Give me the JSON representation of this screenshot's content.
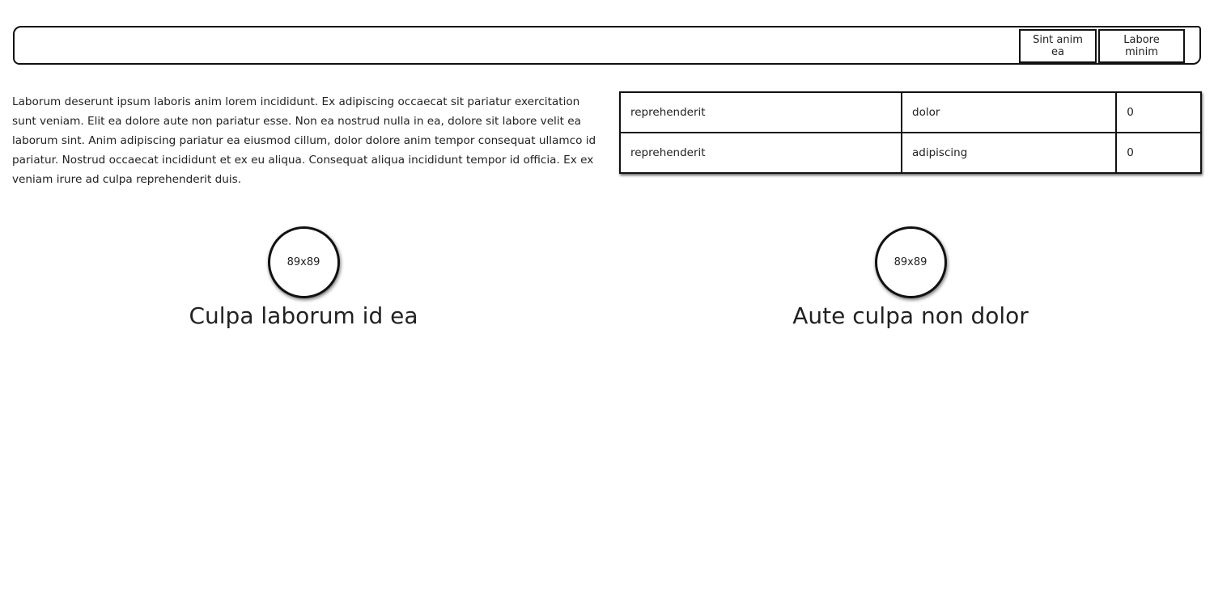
{
  "navbar": {
    "buttons": [
      {
        "label": "Sint anim ea"
      },
      {
        "label": "Labore minim"
      }
    ]
  },
  "content": {
    "paragraph": "Laborum deserunt ipsum laboris anim lorem incididunt. Ex adipiscing occaecat sit pariatur exercitation sunt veniam. Elit ea dolore aute non pariatur esse. Non ea nostrud nulla in ea, dolore sit labore velit ea laborum sint. Anim adipiscing pariatur ea eiusmod cillum, dolor dolore anim tempor consequat ullamco id pariatur. Nostrud occaecat incididunt et ex eu aliqua. Consequat aliqua incididunt tempor id officia. Ex ex veniam irure ad culpa reprehenderit duis."
  },
  "table": {
    "rows": [
      [
        "reprehenderit",
        "dolor",
        "0"
      ],
      [
        "reprehenderit",
        "adipiscing",
        "0"
      ]
    ]
  },
  "profiles": [
    {
      "avatar_label": "89x89",
      "name": "Culpa laborum id ea"
    },
    {
      "avatar_label": "89x89",
      "name": "Aute culpa non dolor"
    }
  ]
}
